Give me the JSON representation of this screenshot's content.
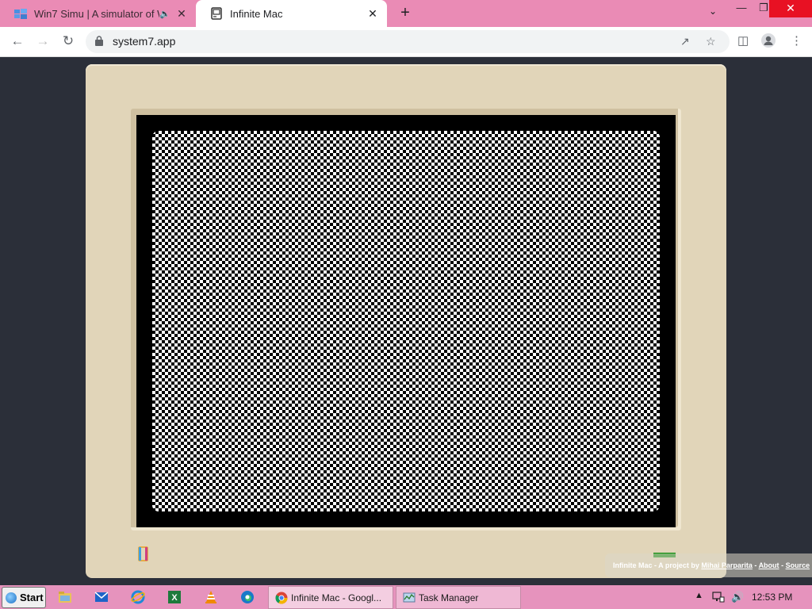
{
  "browser": {
    "tabs": [
      {
        "title": "Win7 Simu | A simulator of W",
        "active": false,
        "audio": true
      },
      {
        "title": "Infinite Mac",
        "active": true,
        "audio": false
      }
    ],
    "url": "system7.app"
  },
  "page": {
    "credit": {
      "text": "Infinite Mac - A project by",
      "author": "Mihai Parparita",
      "sep1": " - ",
      "about": "About",
      "sep2": " - ",
      "source": "Source"
    },
    "led_color": "#0a8a0a"
  },
  "taskbar": {
    "start_label": "Start",
    "tasks": [
      {
        "label": "Infinite Mac - Googl...",
        "icon": "chrome-icon",
        "active": true
      },
      {
        "label": "Task Manager",
        "icon": "task-manager-icon",
        "active": false
      }
    ],
    "clock": "12:53 PM",
    "quick_launch": [
      "file-explorer-icon",
      "mail-icon",
      "internet-explorer-icon",
      "excel-icon",
      "vlc-icon",
      "edge-icon"
    ]
  }
}
